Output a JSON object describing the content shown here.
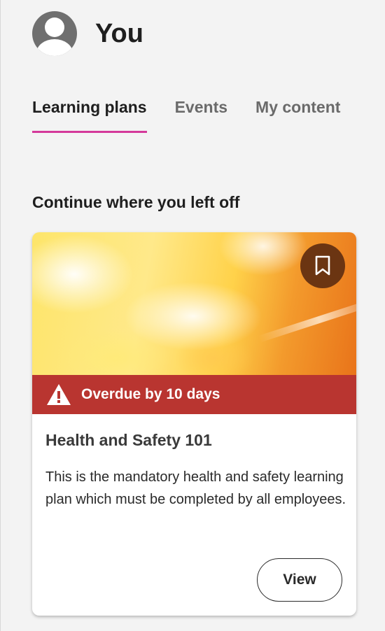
{
  "profile": {
    "name": "You",
    "avatar_icon": "user-avatar-icon"
  },
  "tabs": [
    {
      "label": "Learning plans",
      "active": true
    },
    {
      "label": "Events",
      "active": false
    },
    {
      "label": "My content",
      "active": false
    }
  ],
  "section": {
    "title": "Continue where you left off"
  },
  "card": {
    "image_icon": "course-thumbnail",
    "bookmark_icon": "bookmark-icon",
    "overdue": {
      "icon": "warning-icon",
      "text": "Overdue by 10 days"
    },
    "title": "Health and Safety 101",
    "description": "This is the mandatory health and safety learning plan which must be completed by all employees.",
    "view_label": "View"
  },
  "colors": {
    "tab_indicator": "#d4399a",
    "overdue_banner": "#b93530",
    "bookmark_bg": "#6b3512",
    "page_bg": "#f3f3f3"
  }
}
